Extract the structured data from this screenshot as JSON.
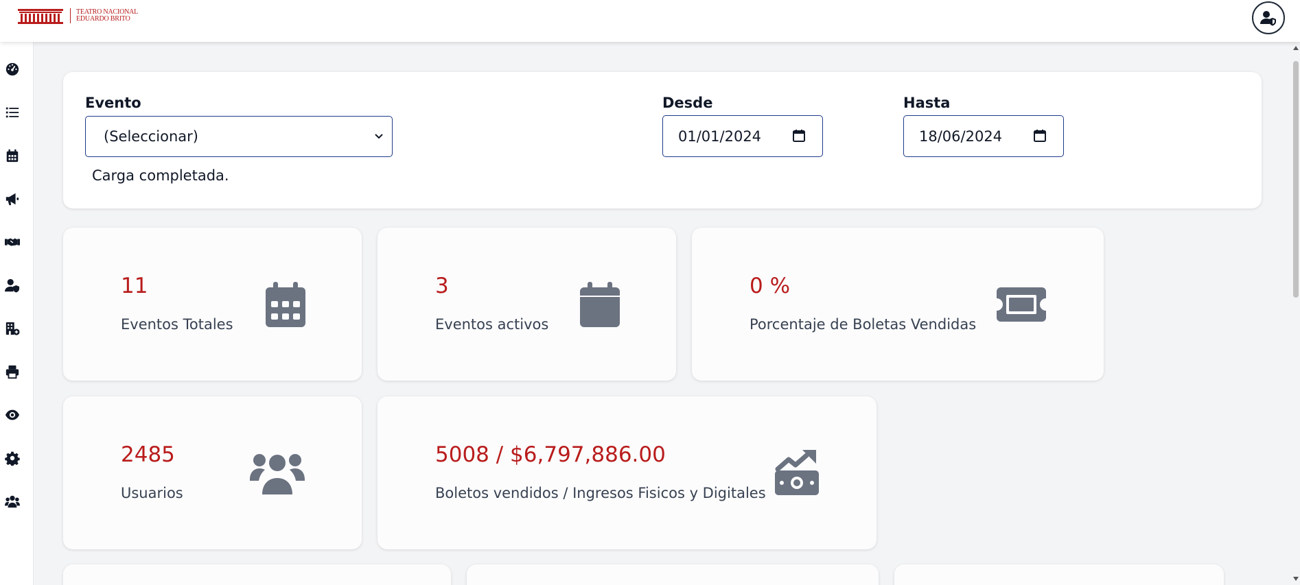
{
  "header": {
    "logo_text_line1": "TEATRO NACIONAL",
    "logo_text_line2": "EDUARDO BRITO",
    "user_icon": "user-shield-icon"
  },
  "sidebar": {
    "items": [
      {
        "icon": "dashboard-gauge-icon"
      },
      {
        "icon": "list-icon"
      },
      {
        "icon": "calendar-icon"
      },
      {
        "icon": "megaphone-icon"
      },
      {
        "icon": "handshake-icon"
      },
      {
        "icon": "user-shield-icon"
      },
      {
        "icon": "building-add-icon"
      },
      {
        "icon": "printer-icon"
      },
      {
        "icon": "eye-icon"
      },
      {
        "icon": "gear-icon"
      },
      {
        "icon": "users-icon"
      }
    ]
  },
  "filters": {
    "event_label": "Evento",
    "event_value": "(Seleccionar)",
    "from_label": "Desde",
    "from_value": "01/01/2024",
    "to_label": "Hasta",
    "to_value": "18/06/2024",
    "status": "Carga completada."
  },
  "stats": {
    "total_events": {
      "value": "11",
      "label": "Eventos Totales",
      "icon": "calendar-grid-icon"
    },
    "active_events": {
      "value": "3",
      "label": "Eventos activos",
      "icon": "calendar-icon"
    },
    "sold_percent": {
      "value": "0 %",
      "label": "Porcentaje de Boletas Vendidas",
      "icon": "ticket-icon"
    },
    "users": {
      "value": "2485",
      "label": "Usuarios",
      "icon": "users-icon"
    },
    "tickets_revenue": {
      "value": "5008 / $6,797,886.00",
      "label": "Boletos vendidos / Ingresos Fisicos y Digitales",
      "icon": "money-growth-icon"
    }
  },
  "colors": {
    "accent": "#b91c1c",
    "icon_gray": "#6b7280",
    "input_border": "#1e3a8a"
  }
}
